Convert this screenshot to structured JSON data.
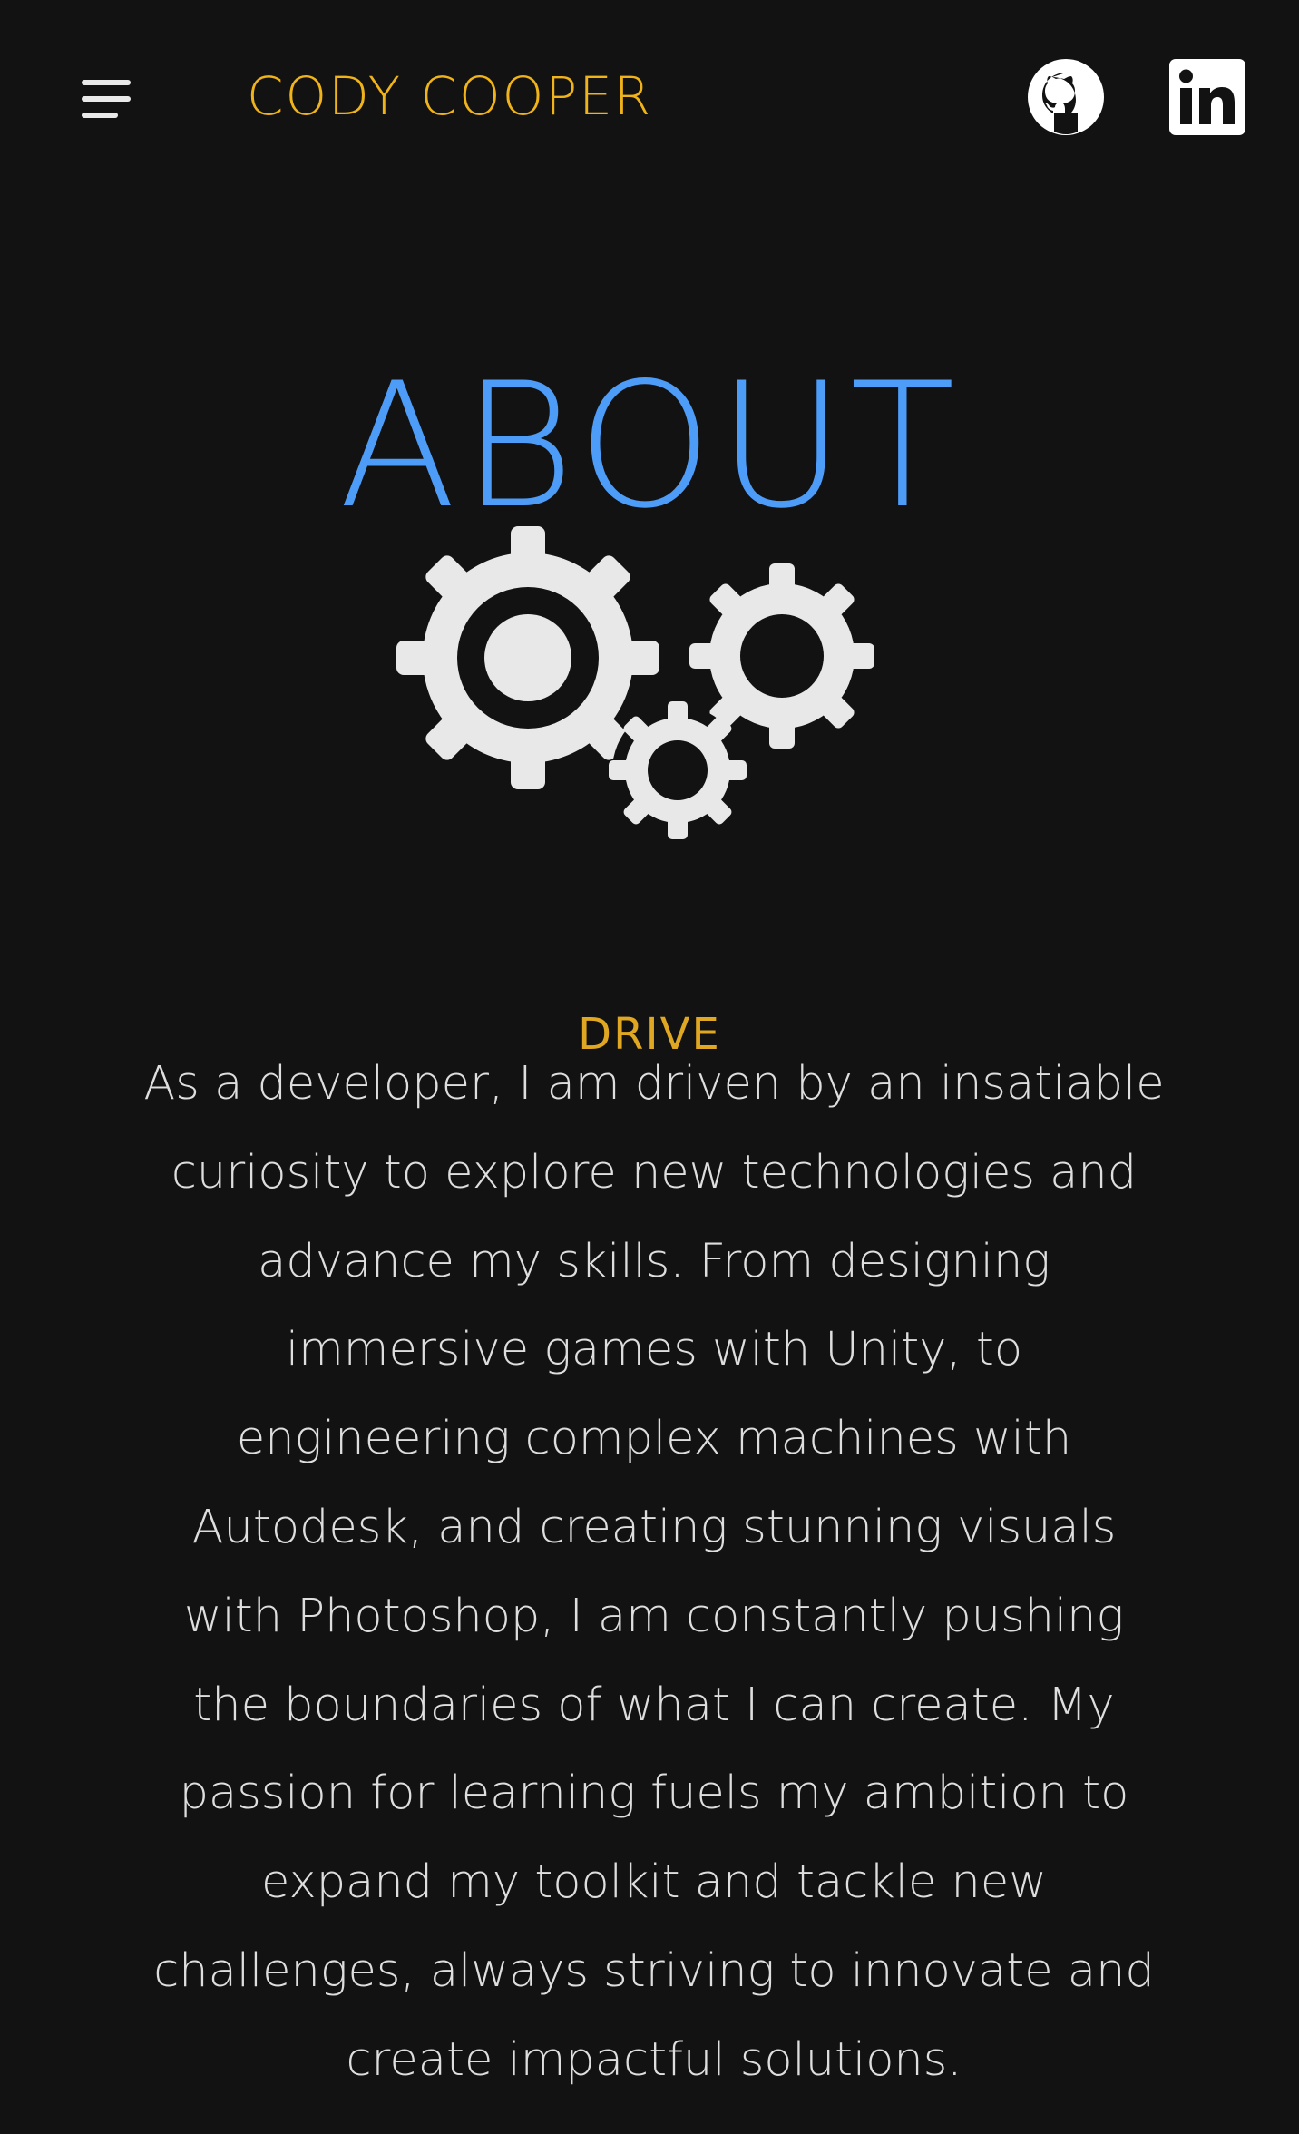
{
  "header": {
    "site_title": "CODY COOPER",
    "menu_icon": "hamburger-menu-icon",
    "social": [
      {
        "name": "github-icon"
      },
      {
        "name": "linkedin-icon"
      }
    ]
  },
  "main": {
    "title": "ABOUT",
    "illustration_icon": "gears-icon",
    "section": {
      "heading": "DRIVE",
      "body": "As a developer, I am driven by an insatiable curiosity to explore new technologies and advance my skills. From designing immersive games with Unity, to engineering complex machines with Autodesk, and creating stunning visuals with Photoshop, I am constantly pushing the boundaries of what I can create. My passion for learning fuels my ambition to expand my toolkit and tackle new challenges, always striving to innovate and create impactful solutions."
    }
  },
  "colors": {
    "background": "#121212",
    "accent_gold": "#f0b31a",
    "accent_blue": "#4d9cf7",
    "text": "#dedede",
    "icon": "#e6e6e6"
  }
}
